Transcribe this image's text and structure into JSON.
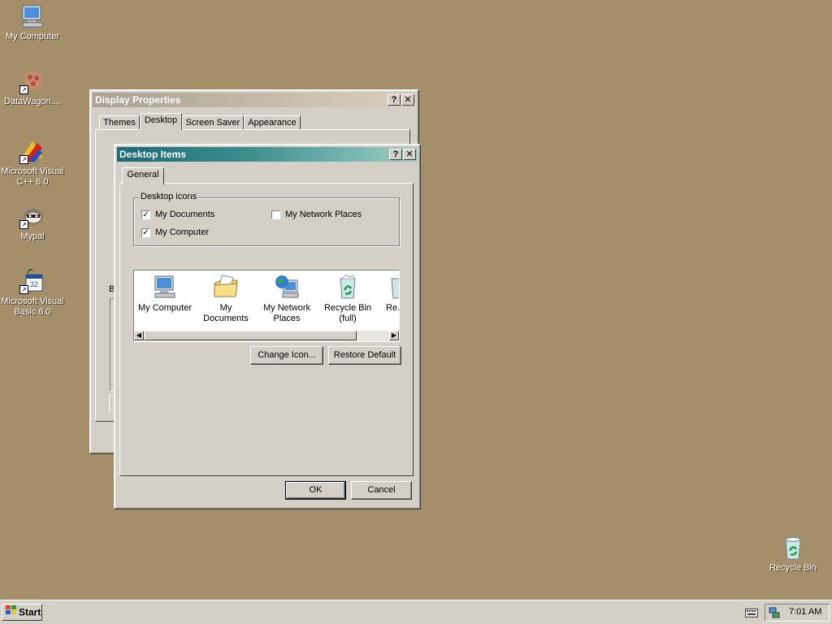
{
  "desktop": {
    "icons": [
      {
        "label": "My Computer",
        "icon": "my-computer-icon"
      },
      {
        "label": "DataWagon....",
        "icon": "datawagon-icon"
      },
      {
        "label": "Microsoft Visual C++ 6.0",
        "icon": "visual-cpp-icon"
      },
      {
        "label": "Mypal",
        "icon": "mypal-icon"
      },
      {
        "label": "Microsoft Visual Basic 6.0",
        "icon": "visual-basic-icon"
      },
      {
        "label": "Recycle Bin",
        "icon": "recycle-bin-icon"
      }
    ]
  },
  "display_properties": {
    "title": "Display Properties",
    "tabs": [
      "Themes",
      "Desktop",
      "Screen Saver",
      "Appearance"
    ],
    "selected_tab": "Desktop",
    "partial_label": "B",
    "help_glyph": "?",
    "close_glyph": "✕"
  },
  "desktop_items": {
    "title": "Desktop Items",
    "tabs": [
      "General"
    ],
    "group_label": "Desktop icons",
    "checkboxes": [
      {
        "label": "My Documents",
        "checked": true
      },
      {
        "label": "My Network Places",
        "checked": false
      },
      {
        "label": "My Computer",
        "checked": true
      }
    ],
    "icon_list": [
      {
        "label": "My Computer",
        "icon": "my-computer-icon"
      },
      {
        "label": "My Documents",
        "icon": "my-documents-icon"
      },
      {
        "label": "My Network Places",
        "icon": "network-places-icon"
      },
      {
        "label": "Recycle Bin (full)",
        "icon": "recycle-bin-full-icon"
      },
      {
        "label": "Re...",
        "icon": "recycle-bin-empty-icon"
      }
    ],
    "change_icon_label": "Change Icon...",
    "restore_default_label": "Restore Default",
    "ok_label": "OK",
    "cancel_label": "Cancel",
    "help_glyph": "?",
    "close_glyph": "✕",
    "check_glyph": "✓"
  },
  "taskbar": {
    "start_label": "Start",
    "clock": "7:01 AM"
  }
}
